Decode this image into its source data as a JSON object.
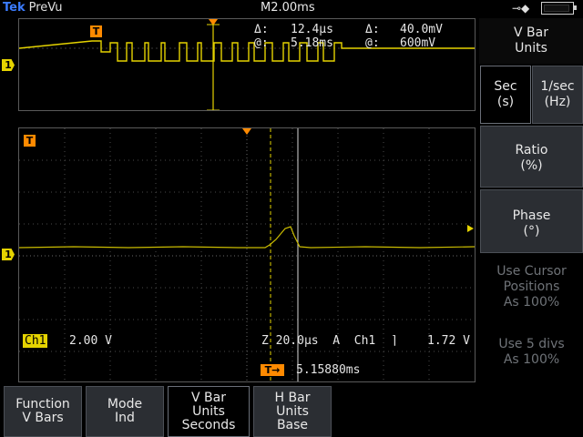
{
  "topbar": {
    "brand": "Tek",
    "mode": "PreVu",
    "timebase": "M2.00ms",
    "power_icon": "ac-plug-icon",
    "battery_icon": "battery-icon"
  },
  "preview": {
    "delta_time_label": "Δ:",
    "delta_time": "12.4µs",
    "delta_volt_label": "Δ:",
    "delta_volt": "40.0mV",
    "at_time_label": "@:",
    "at_time": "5.18ms",
    "at_volt_label": "@:",
    "at_volt": "600mV",
    "trigger_marker": "T",
    "channel_marker": "1"
  },
  "main": {
    "trigger_marker": "T",
    "channel_marker": "1",
    "ch_label": "Ch1",
    "ch_scale": "2.00 V",
    "zoom_readout": "Z 20.0µs  A  Ch1",
    "trigger_level": "1.72 V",
    "trigger_pos_icon": "T→",
    "trigger_time": "5.15880ms"
  },
  "side_menu": {
    "title_line1": "V Bar",
    "title_line2": "Units",
    "sec_line1": "Sec",
    "sec_line2": "(s)",
    "hz_line1": "1/sec",
    "hz_line2": "(Hz)",
    "ratio_line1": "Ratio",
    "ratio_line2": "(%)",
    "phase_line1": "Phase",
    "phase_line2": "(°)",
    "cursor_line1": "Use Cursor",
    "cursor_line2": "Positions",
    "cursor_line3": "As 100%",
    "divs_line1": "Use 5 divs",
    "divs_line2": "As 100%"
  },
  "bottom_menu": {
    "function_line1": "Function",
    "function_line2": "V Bars",
    "mode_line1": "Mode",
    "mode_line2": "Ind",
    "vbar_line1": "V Bar",
    "vbar_line2": "Units",
    "vbar_line3": "Seconds",
    "hbar_line1": "H Bar",
    "hbar_line2": "Units",
    "hbar_line3": "Base"
  },
  "colors": {
    "trace": "#e5d300",
    "trigger": "#ff8a00",
    "grid": "#4a4a4a",
    "brand": "#3b7cff"
  }
}
